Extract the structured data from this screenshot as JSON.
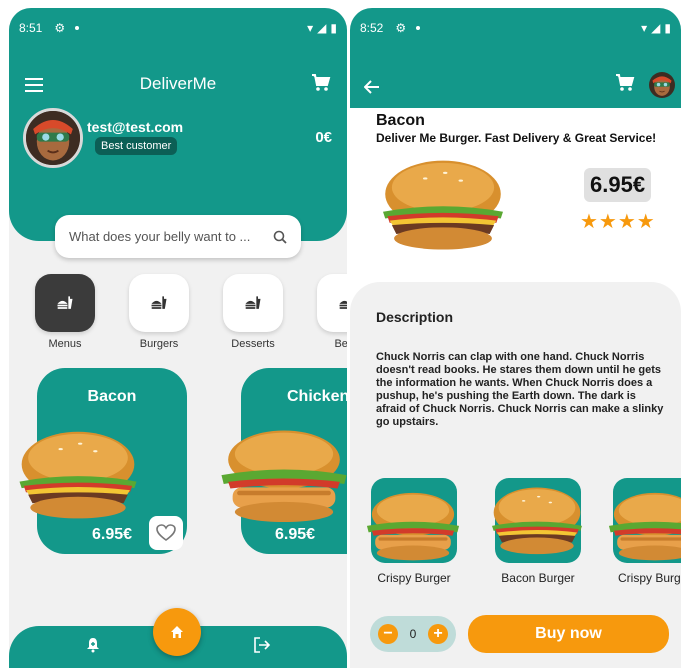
{
  "colors": {
    "primary": "#13988a",
    "accent": "#f7990d",
    "dark": "#3b3b3b"
  },
  "screen1": {
    "status": {
      "time": "8:51"
    },
    "header": {
      "title": "DeliverMe",
      "menu_icon": "menu-icon",
      "cart_icon": "cart-icon"
    },
    "profile": {
      "email": "test@test.com",
      "badge": "Best customer",
      "balance": "0€"
    },
    "search": {
      "placeholder": "What does your belly want to ..."
    },
    "categories": [
      {
        "label": "Menus",
        "active": true
      },
      {
        "label": "Burgers",
        "active": false
      },
      {
        "label": "Desserts",
        "active": false
      },
      {
        "label": "Beve",
        "active": false
      }
    ],
    "cards": [
      {
        "title": "Bacon",
        "price": "6.95€"
      },
      {
        "title": "Chicken",
        "price": "6.95€"
      }
    ],
    "bottom_nav": {
      "home_icon": "home-icon",
      "bell_icon": "bell-icon",
      "logout_icon": "logout-icon"
    }
  },
  "screen2": {
    "status": {
      "time": "8:52"
    },
    "product": {
      "title": "Bacon",
      "subtitle": "Deliver Me Burger. Fast Delivery & Great Service!",
      "price": "6.95€",
      "stars": "★★★★"
    },
    "description": {
      "title": "Description",
      "text": "Chuck Norris can clap with one hand. Chuck Norris doesn't read books. He stares them down until he gets the information he wants. When Chuck Norris does a pushup, he's pushing the Earth down. The dark is afraid of Chuck Norris. Chuck Norris can make a slinky go upstairs."
    },
    "related": [
      {
        "name": "Crispy Burger"
      },
      {
        "name": "Bacon Burger"
      },
      {
        "name": "Crispy Burg"
      }
    ],
    "quantity": {
      "value": "0",
      "minus": "−",
      "plus": "+"
    },
    "buy_label": "Buy now"
  }
}
